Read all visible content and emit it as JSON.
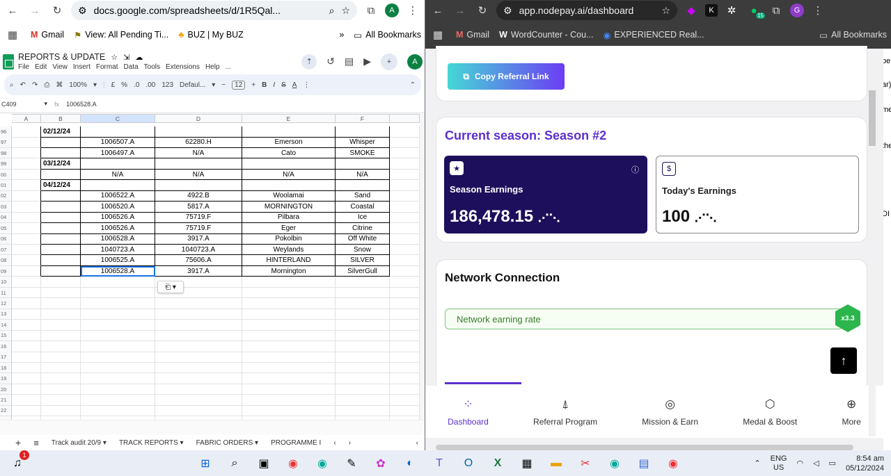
{
  "left_browser": {
    "url": "docs.google.com/spreadsheets/d/1R5Qal...",
    "avatar": "A",
    "bookmarks": [
      "Gmail",
      "View: All Pending Ti...",
      "BUZ | My BUZ"
    ],
    "all_bookmarks": "All Bookmarks"
  },
  "sheet": {
    "title": "REPORTS & UPDATE",
    "menu": [
      "File",
      "Edit",
      "View",
      "Insert",
      "Format",
      "Data",
      "Tools",
      "Extensions",
      "Help",
      "..."
    ],
    "zoom": "100%",
    "currency": "£",
    "percent": "%",
    "dec_minus": ".0",
    "dec_plus": ".00",
    "num_fmt": "123",
    "font": "Defaul...",
    "font_size": "12",
    "bold": "B",
    "italic": "I",
    "strike": "S",
    "textcolor": "A",
    "name_box": "C409",
    "formula": "1006528.A",
    "columns": [
      "A",
      "B",
      "C",
      "D",
      "E",
      "F"
    ],
    "rows": [
      {
        "n": "96",
        "b": "02/12/24",
        "c": "",
        "d": "",
        "e": "",
        "f": ""
      },
      {
        "n": "97",
        "b": "",
        "c": "1006507.A",
        "d": "62280.H",
        "e": "Emerson",
        "f": "Whisper"
      },
      {
        "n": "98",
        "b": "",
        "c": "1006497.A",
        "d": "N/A",
        "e": "Cato",
        "f": "SMOKE"
      },
      {
        "n": "99",
        "b": "03/12/24",
        "c": "",
        "d": "",
        "e": "",
        "f": ""
      },
      {
        "n": "00",
        "b": "",
        "c": "N/A",
        "d": "N/A",
        "e": "N/A",
        "f": "N/A"
      },
      {
        "n": "01",
        "b": "04/12/24",
        "c": "",
        "d": "",
        "e": "",
        "f": ""
      },
      {
        "n": "02",
        "b": "",
        "c": "1006522.A",
        "d": "4922.B",
        "e": "Woolamai",
        "f": "Sand"
      },
      {
        "n": "03",
        "b": "",
        "c": "1006520.A",
        "d": "5817.A",
        "e": "MORNINGTON",
        "f": "Coastal"
      },
      {
        "n": "04",
        "b": "",
        "c": "1006526.A",
        "d": "75719.F",
        "e": "Pilbara",
        "f": "Ice"
      },
      {
        "n": "05",
        "b": "",
        "c": "1006526.A",
        "d": "75719.F",
        "e": "Eger",
        "f": "Citrine"
      },
      {
        "n": "06",
        "b": "",
        "c": "1006528.A",
        "d": "3917.A",
        "e": "Pokolbin",
        "f": "Off White"
      },
      {
        "n": "07",
        "b": "",
        "c": "1040723.A",
        "d": "1040723.A",
        "e": "Weylands",
        "f": "Snow"
      },
      {
        "n": "08",
        "b": "",
        "c": "1006525.A",
        "d": "75606.A",
        "e": "HINTERLAND",
        "f": "SILVER"
      },
      {
        "n": "09",
        "b": "",
        "c": "1006528.A",
        "d": "3917.A",
        "e": "Mornington",
        "f": "SilverGull"
      },
      {
        "n": "10",
        "b": "",
        "c": "",
        "d": "",
        "e": "",
        "f": ""
      },
      {
        "n": "11",
        "b": "",
        "c": "",
        "d": "",
        "e": "",
        "f": ""
      },
      {
        "n": "12",
        "b": "",
        "c": "",
        "d": "",
        "e": "",
        "f": ""
      },
      {
        "n": "13",
        "b": "",
        "c": "",
        "d": "",
        "e": "",
        "f": ""
      },
      {
        "n": "14",
        "b": "",
        "c": "",
        "d": "",
        "e": "",
        "f": ""
      },
      {
        "n": "15",
        "b": "",
        "c": "",
        "d": "",
        "e": "",
        "f": ""
      },
      {
        "n": "16",
        "b": "",
        "c": "",
        "d": "",
        "e": "",
        "f": ""
      },
      {
        "n": "17",
        "b": "",
        "c": "",
        "d": "",
        "e": "",
        "f": ""
      },
      {
        "n": "18",
        "b": "",
        "c": "",
        "d": "",
        "e": "",
        "f": ""
      },
      {
        "n": "19",
        "b": "",
        "c": "",
        "d": "",
        "e": "",
        "f": ""
      },
      {
        "n": "20",
        "b": "",
        "c": "",
        "d": "",
        "e": "",
        "f": ""
      },
      {
        "n": "21",
        "b": "",
        "c": "",
        "d": "",
        "e": "",
        "f": ""
      },
      {
        "n": "22",
        "b": "",
        "c": "",
        "d": "",
        "e": "",
        "f": ""
      },
      {
        "n": "23",
        "b": "",
        "c": "",
        "d": "",
        "e": "",
        "f": ""
      },
      {
        "n": "24",
        "b": "",
        "c": "",
        "d": "",
        "e": "",
        "f": ""
      },
      {
        "n": "25",
        "b": "",
        "c": "",
        "d": "",
        "e": "",
        "f": ""
      },
      {
        "n": "26",
        "b": "",
        "c": "",
        "d": "",
        "e": "",
        "f": ""
      }
    ],
    "tabs": [
      "Track audit 20/9",
      "TRACK REPORTS",
      "FABRIC ORDERS",
      "PROGRAMME I"
    ]
  },
  "right_browser": {
    "url": "app.nodepay.ai/dashboard",
    "avatar": "G",
    "ext_badge": "15",
    "bookmarks": [
      "Gmail",
      "WordCounter - Cou...",
      "EXPERIENCED Real..."
    ],
    "all_bookmarks": "All Bookmarks"
  },
  "nodepay": {
    "copy_referral": "Copy Referral Link",
    "season_title": "Current season: Season #2",
    "season_earnings_label": "Season Earnings",
    "season_earnings_value": "186,478.15",
    "today_earnings_label": "Today's Earnings",
    "today_earnings_value": "100",
    "network_title": "Network Connection",
    "network_rate_label": "Network earning rate",
    "network_multiplier": "x3.3",
    "nav": [
      "Dashboard",
      "Referral Program",
      "Mission & Earn",
      "Medal & Boost",
      "More"
    ],
    "edge_text": [
      "pen",
      "ar)",
      "me",
      "the",
      ": DI"
    ]
  },
  "taskbar": {
    "notification": "1",
    "language": "ENG",
    "region": "US",
    "time": "8:54 am",
    "date": "05/12/2024"
  }
}
